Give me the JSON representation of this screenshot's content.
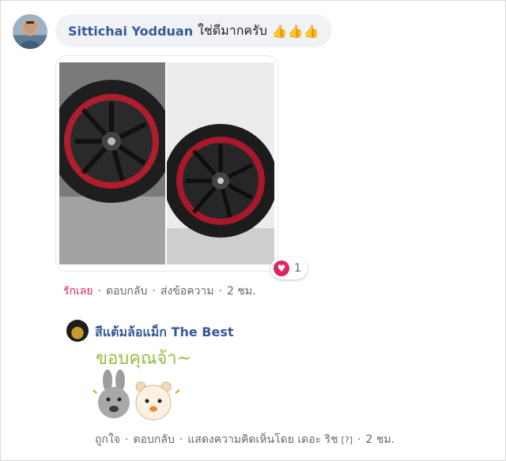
{
  "comment": {
    "author": "Sittichai Yodduan",
    "text": "ใช่ดีมากครับ",
    "emoji": "👍👍👍",
    "reaction_count": "1",
    "actions": {
      "love": "รักเลย",
      "reply": "ตอบกลับ",
      "message": "ส่งข้อความ",
      "time": "2 ชม."
    }
  },
  "reply": {
    "author": "สีแต้มล้อแม็ก The Best",
    "sticker_text": "ขอบคุณจ้า~",
    "actions": {
      "like": "ถูกใจ",
      "reply": "ตอบกลับ",
      "by": "แสดงความคิดเห็นโดย เดอะ ริช",
      "badge": "[?]",
      "time": "2 ชม."
    }
  },
  "colors": {
    "link_blue": "#385898",
    "love_red": "#e0245e",
    "meta_gray": "#65676b",
    "bubble_bg": "#f0f2f5",
    "sticker_green": "#8fbf3a"
  },
  "icons": [
    "thumbs-up-icon",
    "heart-icon"
  ]
}
